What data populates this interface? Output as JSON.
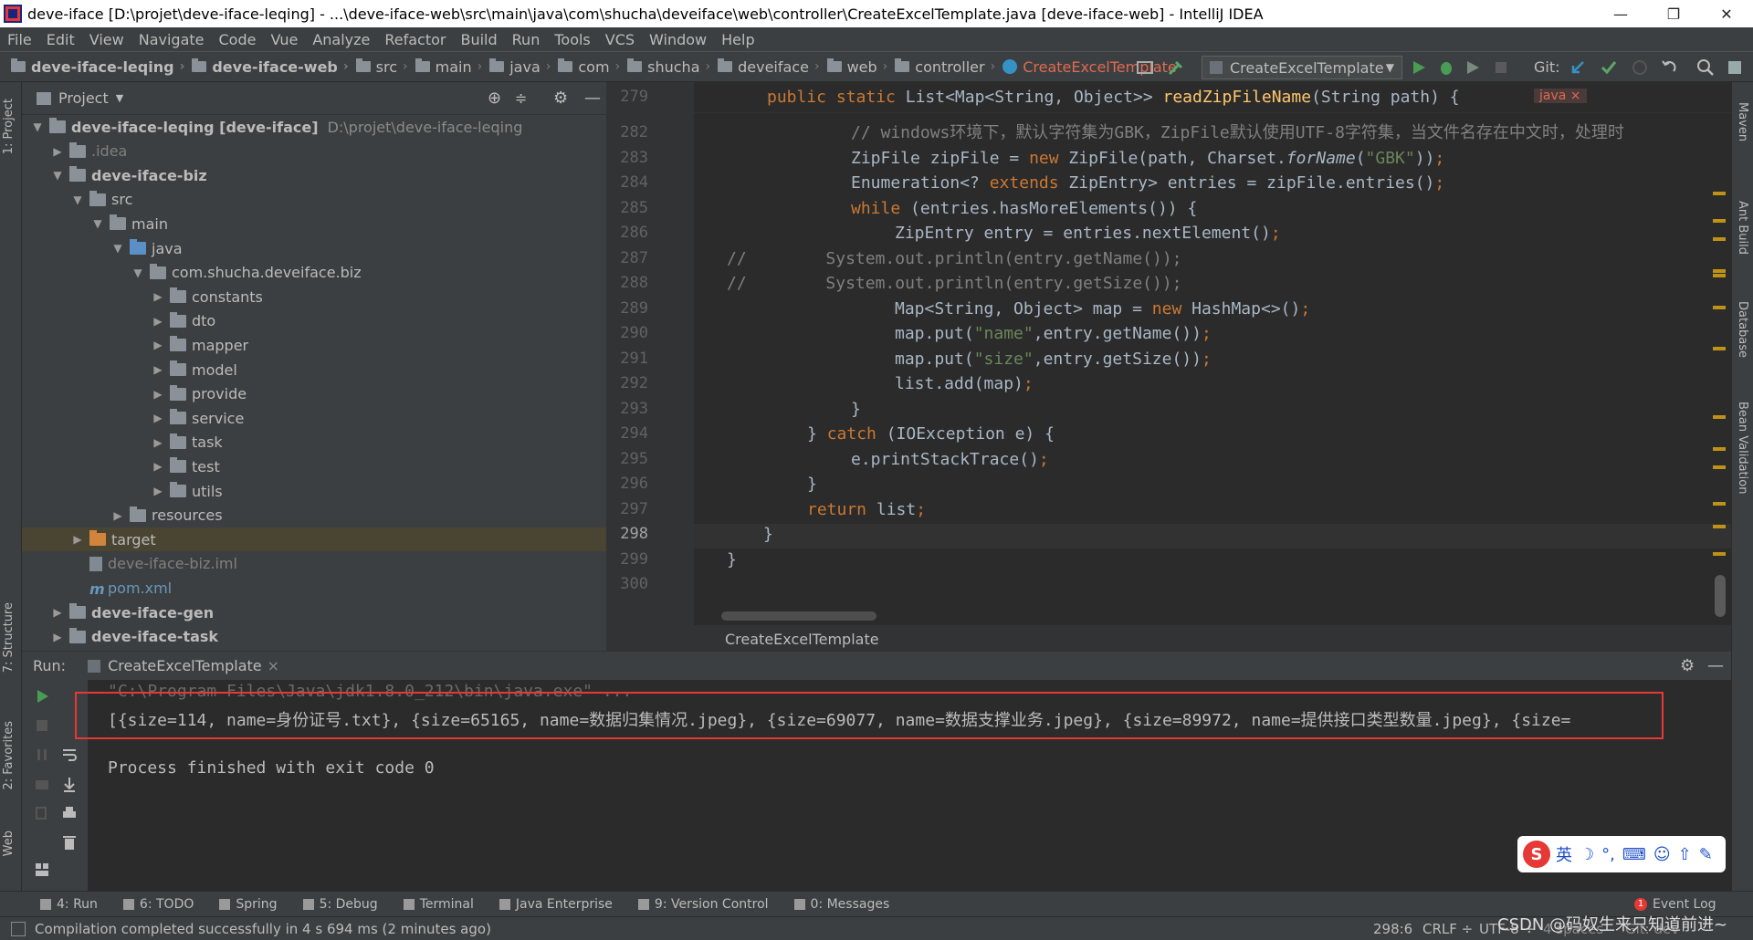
{
  "window": {
    "title": "deve-iface [D:\\projet\\deve-iface-leqing] - ...\\deve-iface-web\\src\\main\\java\\com\\shucha\\deveiface\\web\\controller\\CreateExcelTemplate.java [deve-iface-web] - IntelliJ IDEA",
    "minimize": "—",
    "restore": "❐",
    "close": "✕"
  },
  "menu": [
    "File",
    "Edit",
    "View",
    "Navigate",
    "Code",
    "Vue",
    "Analyze",
    "Refactor",
    "Build",
    "Run",
    "Tools",
    "VCS",
    "Window",
    "Help"
  ],
  "breadcrumb": [
    "deve-iface-leqing",
    "deve-iface-web",
    "src",
    "main",
    "java",
    "com",
    "shucha",
    "deveiface",
    "web",
    "controller",
    "CreateExcelTemplate"
  ],
  "toolbar": {
    "run_config": "CreateExcelTemplate",
    "git_label": "Git:"
  },
  "project": {
    "header": "Project",
    "tree": [
      {
        "label": "deve-iface-leqing [deve-iface]",
        "extra": "D:\\projet\\deve-iface-leqing",
        "level": 0,
        "arrow": "▼",
        "bold": true
      },
      {
        "label": ".idea",
        "level": 1,
        "arrow": "▶",
        "dim": true
      },
      {
        "label": "deve-iface-biz",
        "level": 1,
        "arrow": "▼",
        "bold": true
      },
      {
        "label": "src",
        "level": 2,
        "arrow": "▼"
      },
      {
        "label": "main",
        "level": 3,
        "arrow": "▼"
      },
      {
        "label": "java",
        "level": 4,
        "arrow": "▼",
        "blue": true
      },
      {
        "label": "com.shucha.deveiface.biz",
        "level": 5,
        "arrow": "▼"
      },
      {
        "label": "constants",
        "level": 6,
        "arrow": "▶"
      },
      {
        "label": "dto",
        "level": 6,
        "arrow": "▶"
      },
      {
        "label": "mapper",
        "level": 6,
        "arrow": "▶"
      },
      {
        "label": "model",
        "level": 6,
        "arrow": "▶"
      },
      {
        "label": "provide",
        "level": 6,
        "arrow": "▶"
      },
      {
        "label": "service",
        "level": 6,
        "arrow": "▶"
      },
      {
        "label": "task",
        "level": 6,
        "arrow": "▶"
      },
      {
        "label": "test",
        "level": 6,
        "arrow": "▶"
      },
      {
        "label": "utils",
        "level": 6,
        "arrow": "▶"
      },
      {
        "label": "resources",
        "level": 4,
        "arrow": "▶"
      },
      {
        "label": "target",
        "level": 2,
        "arrow": "▶",
        "orange": true,
        "highlight": true
      },
      {
        "label": "deve-iface-biz.iml",
        "level": 2,
        "arrow": "",
        "dim": true,
        "file": true
      },
      {
        "label": "pom.xml",
        "level": 2,
        "arrow": "",
        "maven": true,
        "file": true
      },
      {
        "label": "deve-iface-gen",
        "level": 1,
        "arrow": "▶",
        "bold": true
      },
      {
        "label": "deve-iface-task",
        "level": 1,
        "arrow": "▶",
        "bold": true
      }
    ]
  },
  "editor": {
    "tab_label": "java",
    "sticky": {
      "line": "279",
      "text": "public static List<Map<String, Object>> readZipFileName(String path) {"
    },
    "lines": [
      {
        "n": "282",
        "html": "<span class=\"cm\">// windows环境下，默认字符集为GBK，ZipFile默认使用UTF-8字符集，当文件名存在中文时，处理时</span>",
        "indent": 2
      },
      {
        "n": "283",
        "html": "ZipFile zipFile = <span class=\"kw\">new</span> ZipFile(path, Charset.<span class=\"it\">forName</span>(<span class=\"str\">\"GBK\"</span>))<span class=\"kw\">;</span>",
        "indent": 2
      },
      {
        "n": "284",
        "html": "Enumeration&lt;? <span class=\"kw\">extends</span> ZipEntry&gt; entries = zipFile.entries()<span class=\"kw\">;</span>",
        "indent": 2
      },
      {
        "n": "285",
        "html": "<span class=\"kw\">while</span> (entries.hasMoreElements()) {",
        "indent": 2
      },
      {
        "n": "286",
        "html": "ZipEntry entry = entries.nextElement()<span class=\"kw\">;</span>",
        "indent": 3
      },
      {
        "n": "287",
        "html": "<span class=\"cm\">//</span>        <span class=\"cm\">System.out.println(entry.getName());</span>",
        "indent": 0,
        "comment": true
      },
      {
        "n": "288",
        "html": "<span class=\"cm\">//</span>        <span class=\"cm\">System.out.println(entry.getSize());</span>",
        "indent": 0,
        "comment": true
      },
      {
        "n": "289",
        "html": "Map&lt;String, Object&gt; map = <span class=\"kw\">new</span> HashMap&lt;&gt;()<span class=\"kw\">;</span>",
        "indent": 3
      },
      {
        "n": "290",
        "html": "map.put(<span class=\"str\">\"name\"</span>,entry.getName())<span class=\"kw\">;</span>",
        "indent": 3
      },
      {
        "n": "291",
        "html": "map.put(<span class=\"str\">\"size\"</span>,entry.getSize())<span class=\"kw\">;</span>",
        "indent": 3
      },
      {
        "n": "292",
        "html": "list.add(map)<span class=\"kw\">;</span>",
        "indent": 3
      },
      {
        "n": "293",
        "html": "}",
        "indent": 2
      },
      {
        "n": "294",
        "html": "} <span class=\"kw\">catch</span> (IOException e) {",
        "indent": 1
      },
      {
        "n": "295",
        "html": "e.printStackTrace()<span class=\"kw\">;</span>",
        "indent": 2
      },
      {
        "n": "296",
        "html": "}",
        "indent": 1
      },
      {
        "n": "297",
        "html": "<span class=\"kw\">return</span> list<span class=\"kw\">;</span>",
        "indent": 1
      },
      {
        "n": "298",
        "html": "}",
        "indent": 0,
        "current": true
      },
      {
        "n": "299",
        "html": "}",
        "indent": 0,
        "outer": true
      },
      {
        "n": "300",
        "html": "",
        "indent": 0
      }
    ],
    "footer": "CreateExcelTemplate"
  },
  "run": {
    "label": "Run:",
    "tab": "CreateExcelTemplate",
    "cmd": "\"C:\\Program Files\\Java\\jdk1.8.0_212\\bin\\java.exe\" ...",
    "output": "[{size=114, name=身份证号.txt}, {size=65165, name=数据归集情况.jpeg}, {size=69077, name=数据支撑业务.jpeg}, {size=89972, name=提供接口类型数量.jpeg}, {size=",
    "finished": "Process finished with exit code 0"
  },
  "bottom_tabs": [
    {
      "label": "4: Run"
    },
    {
      "label": "6: TODO"
    },
    {
      "label": "Spring"
    },
    {
      "label": "5: Debug"
    },
    {
      "label": "Terminal"
    },
    {
      "label": "Java Enterprise"
    },
    {
      "label": "9: Version Control"
    },
    {
      "label": "0: Messages"
    }
  ],
  "event_log": "Event Log",
  "event_count": "1",
  "status": {
    "message": "Compilation completed successfully in 4 s 694 ms (2 minutes ago)",
    "position": "298:6",
    "line_sep": "CRLF ÷",
    "encoding": "UTF-8 ÷",
    "indent": "4 spaces",
    "git": "Git: dev",
    "watermark": "CSDN @码奴生来只知道前进~"
  },
  "side_labels": {
    "left": [
      "1: Project",
      "7: Structure",
      "2: Favorites",
      "Web"
    ],
    "right": [
      "Maven",
      "Ant Build",
      "Database",
      "Bean Validation"
    ]
  },
  "ime": {
    "lang": "英"
  },
  "colors": {
    "accent": "#cc7832",
    "string": "#6a8759",
    "highlight_box": "#e53935"
  }
}
